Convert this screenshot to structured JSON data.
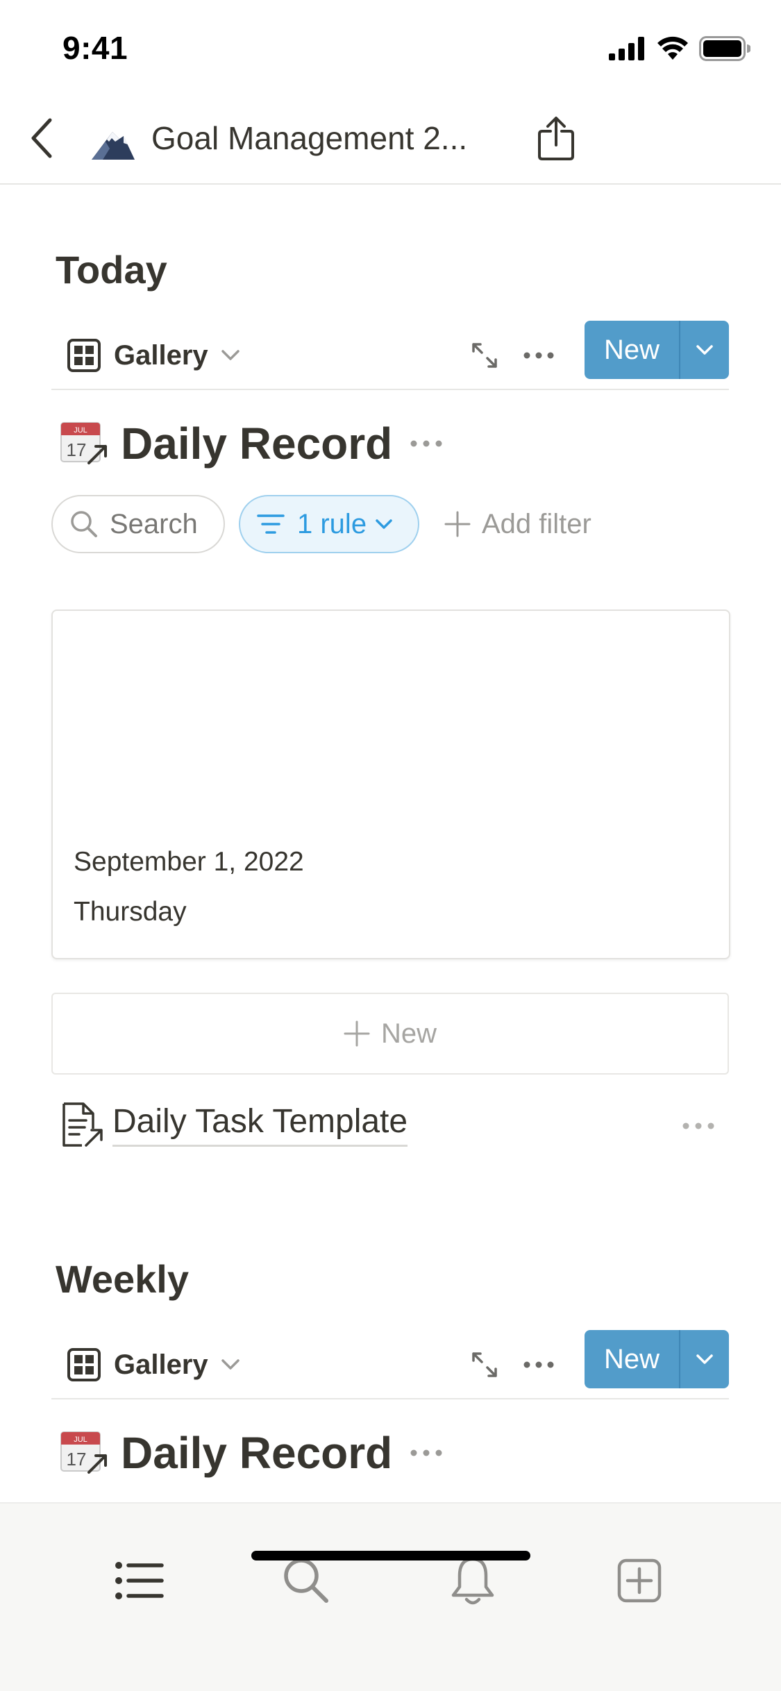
{
  "status_bar": {
    "time": "9:41"
  },
  "nav": {
    "title": "Goal Management 2..."
  },
  "sections": [
    {
      "title": "Today",
      "view": {
        "label": "Gallery",
        "new_label": "New"
      },
      "database": {
        "title": "Daily Record"
      },
      "search": {
        "label": "Search"
      },
      "filter": {
        "rule_label": "1 rule",
        "add_filter_label": "Add filter"
      },
      "card": {
        "date": "September 1, 2022",
        "day": "Thursday"
      },
      "new_row": {
        "label": "New"
      },
      "template": {
        "label": "Daily Task Template"
      }
    },
    {
      "title": "Weekly",
      "view": {
        "label": "Gallery",
        "new_label": "New"
      },
      "database": {
        "title": "Daily Record"
      }
    }
  ],
  "tab_bar": {
    "items": [
      {
        "icon": "list-icon"
      },
      {
        "icon": "search-icon"
      },
      {
        "icon": "bell-icon"
      },
      {
        "icon": "new-page-icon"
      }
    ]
  },
  "colors": {
    "accent": "#529cca",
    "filter_active": "#2d9be0",
    "text": "#37352f"
  }
}
